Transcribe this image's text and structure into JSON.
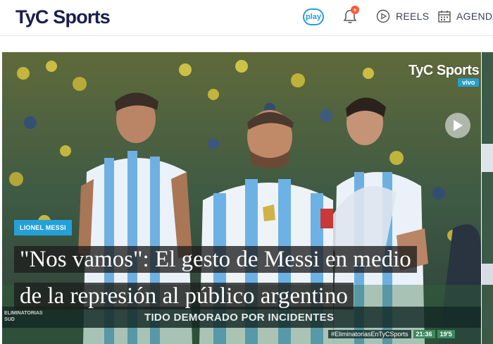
{
  "header": {
    "logo_text": "TyC Sports",
    "play_label": "play",
    "notification_badge": "+",
    "reels_label": "REELS",
    "agenda_label": "AGENDA"
  },
  "hero": {
    "watermark": "TyC Sports",
    "watermark_live": "vivo",
    "tag": "LIONEL MESSI",
    "headline": "\"Nos vamos\": El gesto de Messi en medio de la represión al público argentino",
    "ticker_small": "ELIMINATORIAS\nSUD",
    "ticker_text": "TIDO DEMORADO POR INCIDENTES",
    "hashtag": "#EliminatoriasEnTyCSports",
    "clock": "21:36",
    "minute": "19'5"
  },
  "colors": {
    "brand_navy": "#1a1f4d",
    "accent_blue": "#23a1d9",
    "badge_orange": "#ff5a36"
  }
}
